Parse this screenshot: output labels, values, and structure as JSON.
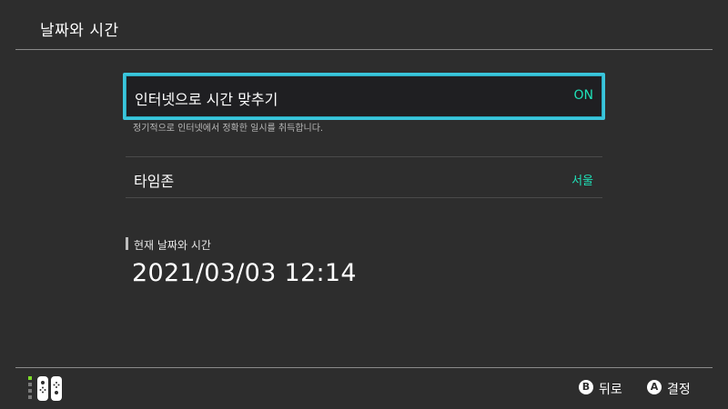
{
  "header": {
    "title": "날짜와 시간"
  },
  "settings": {
    "internet_sync": {
      "label": "인터넷으로 시간 맞추기",
      "value": "ON",
      "hint": "정기적으로 인터넷에서 정확한 일시를 취득합니다."
    },
    "timezone": {
      "label": "타임존",
      "value": "서울"
    }
  },
  "current": {
    "section_title": "현재 날짜와 시간",
    "datetime": "2021/03/03 12:14"
  },
  "footer": {
    "back": {
      "key": "B",
      "label": "뒤로"
    },
    "confirm": {
      "key": "A",
      "label": "결정"
    }
  },
  "colors": {
    "background": "#2d2d2d",
    "focus_border": "#3ac6dc",
    "value_accent": "#1fe1b8",
    "player_led": "#7ddc2a"
  },
  "icons": {
    "controller": "joycon-pair-icon",
    "player_indicator": "player-led-icon"
  }
}
